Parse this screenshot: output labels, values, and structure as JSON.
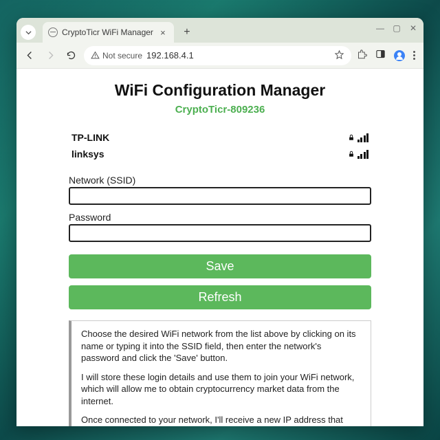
{
  "browser": {
    "tab_title": "CryptoTicr WiFi Manager",
    "not_secure_label": "Not secure",
    "address": "192.168.4.1"
  },
  "page": {
    "heading": "WiFi Configuration Manager",
    "device_name": "CryptoTicr-809236",
    "networks": [
      {
        "ssid": "TP-LINK",
        "secured": true
      },
      {
        "ssid": "linksys",
        "secured": true
      }
    ],
    "form": {
      "ssid_label": "Network (SSID)",
      "ssid_value": "",
      "password_label": "Password",
      "password_value": "",
      "save_label": "Save",
      "refresh_label": "Refresh"
    },
    "help": {
      "p1": "Choose the desired WiFi network from the list above by clicking on its name or typing it into the SSID field, then enter the network's password and click the 'Save' button.",
      "p2": "I will store these login details and use them to join your WiFi network, which will allow me to obtain cryptocurrency market data from the internet.",
      "p3": "Once connected to your network, I'll receive a new IP address that you'll use to complete my setup."
    }
  }
}
